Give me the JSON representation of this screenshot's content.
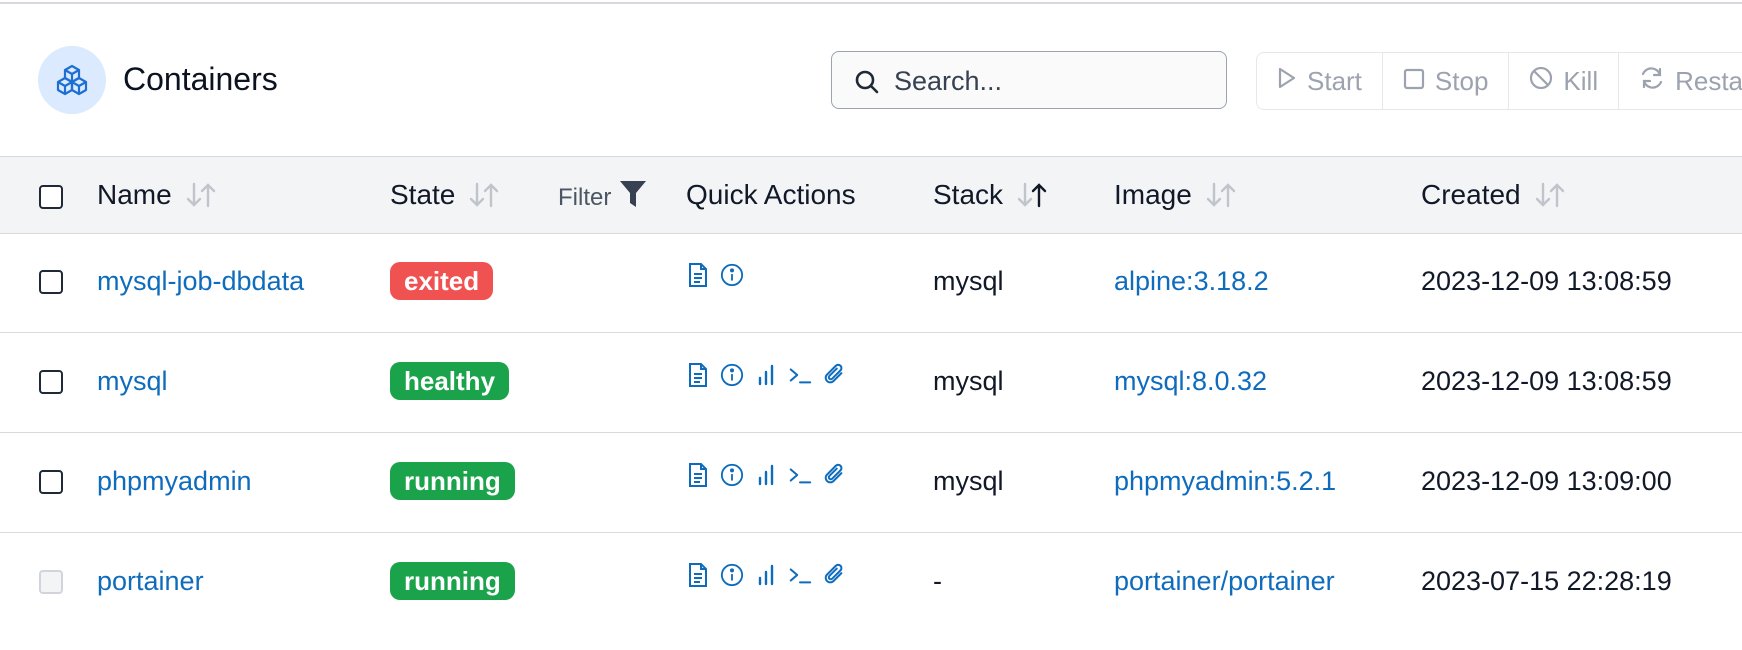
{
  "header": {
    "title": "Containers",
    "title_icon": "cubes-icon",
    "search": {
      "placeholder": "Search...",
      "value": ""
    },
    "actions": [
      {
        "label": "Start",
        "icon": "play-icon"
      },
      {
        "label": "Stop",
        "icon": "stop-icon"
      },
      {
        "label": "Kill",
        "icon": "ban-icon"
      },
      {
        "label": "Restart",
        "icon": "refresh-icon"
      }
    ]
  },
  "table": {
    "columns": {
      "name": "Name",
      "state": "State",
      "filter": "Filter",
      "quick_actions": "Quick Actions",
      "stack": "Stack",
      "image": "Image",
      "created": "Created"
    },
    "rows": [
      {
        "name": "mysql-job-dbdata",
        "state": "exited",
        "stack": "mysql",
        "image": "alpine:3.18.2",
        "created": "2023-12-09 13:08:59"
      },
      {
        "name": "mysql",
        "state": "healthy",
        "stack": "mysql",
        "image": "mysql:8.0.32",
        "created": "2023-12-09 13:08:59"
      },
      {
        "name": "phpmyadmin",
        "state": "running",
        "stack": "mysql",
        "image": "phpmyadmin:5.2.1",
        "created": "2023-12-09 13:09:00"
      },
      {
        "name": "portainer",
        "state": "running",
        "stack": "-",
        "image": "portainer/portainer",
        "created": "2023-07-15 22:28:19"
      }
    ]
  },
  "colors": {
    "link": "#0f6cbd",
    "exited": "#f05252",
    "healthy": "#1aa34a",
    "running": "#1aa34a"
  }
}
